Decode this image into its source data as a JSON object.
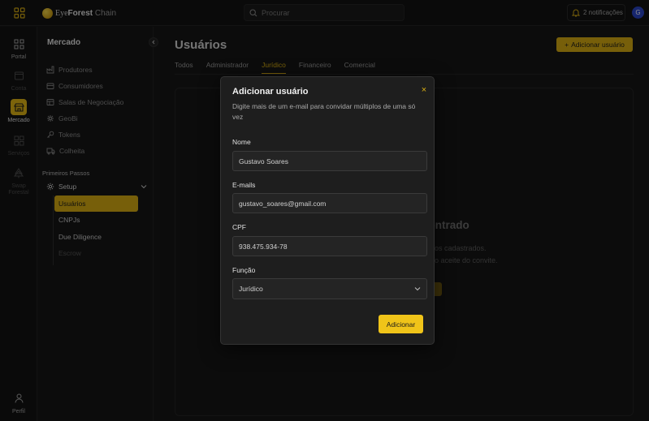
{
  "header": {
    "logo_eye": "Eye",
    "logo_forest": "Forest",
    "logo_chain": " Chain",
    "search_placeholder": "Procurar",
    "notifications": "2 notificações",
    "avatar_initial": "G"
  },
  "rail": {
    "items": [
      {
        "label": "Portal",
        "icon": "grid-icon"
      },
      {
        "label": "Conta",
        "icon": "wallet-icon"
      },
      {
        "label": "Mercado",
        "icon": "market-icon"
      },
      {
        "label": "Serviços",
        "icon": "services-icon"
      },
      {
        "label": "Swap Forestal",
        "icon": "tree-icon"
      }
    ],
    "profile": "Perfil"
  },
  "sidebar": {
    "title": "Mercado",
    "items": [
      {
        "label": "Produtores",
        "icon": "factory-icon"
      },
      {
        "label": "Consumidores",
        "icon": "users-icon"
      },
      {
        "label": "Salas de Negociação",
        "icon": "handshake-icon"
      },
      {
        "label": "GeoBi",
        "icon": "geo-icon"
      },
      {
        "label": "Tokens",
        "icon": "key-icon"
      },
      {
        "label": "Colheita",
        "icon": "truck-icon"
      }
    ],
    "section_label": "Primeiros Passos",
    "setup_label": "Setup",
    "setup_items": [
      "Usuários",
      "CNPJs",
      "Due Diligence",
      "Escrow"
    ]
  },
  "main": {
    "title": "Usuários",
    "add_button": "Adicionar usuário",
    "tabs": [
      "Todos",
      "Administrador",
      "Jurídico",
      "Financeiro",
      "Comercial"
    ],
    "empty_title": "contrado",
    "empty_line1": "ários cadastrados.",
    "empty_line2": "o aceite do convite."
  },
  "modal": {
    "title": "Adicionar usuário",
    "close": "×",
    "description": "Digite mais de um e-mail para convidar múltiplos de uma só vez",
    "name_label": "Nome",
    "name_value": "Gustavo Soares",
    "emails_label": "E-mails",
    "emails_value": "gustavo_soares@gmail.com",
    "cpf_label": "CPF",
    "cpf_value": "938.475.934-78",
    "role_label": "Função",
    "role_value": "Jurídico",
    "submit": "Adicionar"
  },
  "colors": {
    "accent": "#d9ae13",
    "background": "#161616",
    "avatar": "#2b46c9"
  }
}
